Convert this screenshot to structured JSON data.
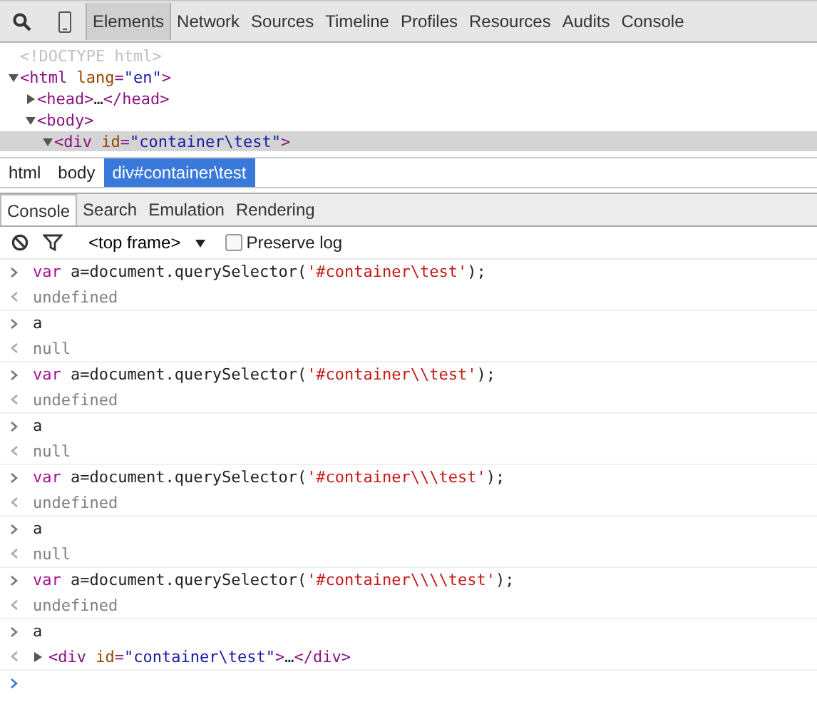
{
  "toolbar": {
    "tabs": [
      {
        "label": "Elements",
        "selected": true
      },
      {
        "label": "Network",
        "selected": false
      },
      {
        "label": "Sources",
        "selected": false
      },
      {
        "label": "Timeline",
        "selected": false
      },
      {
        "label": "Profiles",
        "selected": false
      },
      {
        "label": "Resources",
        "selected": false
      },
      {
        "label": "Audits",
        "selected": false
      },
      {
        "label": "Console",
        "selected": false
      }
    ]
  },
  "dom_tree": [
    {
      "selected": false,
      "segments": [
        {
          "kind": "doctype",
          "text": "<!DOCTYPE html>"
        }
      ]
    },
    {
      "expanded": true,
      "selected": false,
      "segments": [
        {
          "kind": "tag",
          "text": "<html "
        },
        {
          "kind": "attr",
          "text": "lang"
        },
        {
          "kind": "tag",
          "text": "="
        },
        {
          "kind": "value",
          "text": "\"en\""
        },
        {
          "kind": "tag",
          "text": ">"
        }
      ],
      "children": [
        {
          "expanded": false,
          "selected": false,
          "segments": [
            {
              "kind": "tag",
              "text": "<head>"
            },
            {
              "kind": "plain",
              "text": "…"
            },
            {
              "kind": "tag",
              "text": "</head>"
            }
          ]
        },
        {
          "expanded": true,
          "selected": false,
          "segments": [
            {
              "kind": "tag",
              "text": "<body>"
            }
          ],
          "children": [
            {
              "expanded": true,
              "selected": true,
              "segments": [
                {
                  "kind": "tag",
                  "text": "<div "
                },
                {
                  "kind": "attr",
                  "text": "id"
                },
                {
                  "kind": "tag",
                  "text": "="
                },
                {
                  "kind": "value",
                  "text": "\"container\\test\""
                },
                {
                  "kind": "tag",
                  "text": ">"
                }
              ]
            }
          ]
        }
      ]
    }
  ],
  "breadcrumbs": [
    {
      "label": "html",
      "selected": false
    },
    {
      "label": "body",
      "selected": false
    },
    {
      "label": "div#container\\test",
      "selected": true
    }
  ],
  "drawer_tabs": [
    {
      "label": "Console",
      "selected": true
    },
    {
      "label": "Search",
      "selected": false
    },
    {
      "label": "Emulation",
      "selected": false
    },
    {
      "label": "Rendering",
      "selected": false
    }
  ],
  "console_toolbar": {
    "frame": "<top frame>",
    "preserve_log": {
      "label": "Preserve log",
      "checked": false
    }
  },
  "console": [
    [
      {
        "kind": "input",
        "segments": [
          {
            "kind": "keyword",
            "text": "var"
          },
          {
            "kind": "plain",
            "text": " a=document.querySelector("
          },
          {
            "kind": "string",
            "text": "'#container\\test'"
          },
          {
            "kind": "plain",
            "text": ");"
          }
        ]
      },
      {
        "kind": "output",
        "segments": [
          {
            "kind": "muted",
            "text": "undefined"
          }
        ]
      }
    ],
    [
      {
        "kind": "input",
        "segments": [
          {
            "kind": "plain",
            "text": "a"
          }
        ]
      },
      {
        "kind": "output",
        "segments": [
          {
            "kind": "muted",
            "text": "null"
          }
        ]
      }
    ],
    [
      {
        "kind": "input",
        "segments": [
          {
            "kind": "keyword",
            "text": "var"
          },
          {
            "kind": "plain",
            "text": " a=document.querySelector("
          },
          {
            "kind": "string",
            "text": "'#container\\\\test'"
          },
          {
            "kind": "plain",
            "text": ");"
          }
        ]
      },
      {
        "kind": "output",
        "segments": [
          {
            "kind": "muted",
            "text": "undefined"
          }
        ]
      }
    ],
    [
      {
        "kind": "input",
        "segments": [
          {
            "kind": "plain",
            "text": "a"
          }
        ]
      },
      {
        "kind": "output",
        "segments": [
          {
            "kind": "muted",
            "text": "null"
          }
        ]
      }
    ],
    [
      {
        "kind": "input",
        "segments": [
          {
            "kind": "keyword",
            "text": "var"
          },
          {
            "kind": "plain",
            "text": " a=document.querySelector("
          },
          {
            "kind": "string",
            "text": "'#container\\\\\\test'"
          },
          {
            "kind": "plain",
            "text": ");"
          }
        ]
      },
      {
        "kind": "output",
        "segments": [
          {
            "kind": "muted",
            "text": "undefined"
          }
        ]
      }
    ],
    [
      {
        "kind": "input",
        "segments": [
          {
            "kind": "plain",
            "text": "a"
          }
        ]
      },
      {
        "kind": "output",
        "segments": [
          {
            "kind": "muted",
            "text": "null"
          }
        ]
      }
    ],
    [
      {
        "kind": "input",
        "segments": [
          {
            "kind": "keyword",
            "text": "var"
          },
          {
            "kind": "plain",
            "text": " a=document.querySelector("
          },
          {
            "kind": "string",
            "text": "'#container\\\\\\\\test'"
          },
          {
            "kind": "plain",
            "text": ");"
          }
        ]
      },
      {
        "kind": "output",
        "segments": [
          {
            "kind": "muted",
            "text": "undefined"
          }
        ]
      }
    ],
    [
      {
        "kind": "input",
        "segments": [
          {
            "kind": "plain",
            "text": "a"
          }
        ]
      },
      {
        "kind": "output",
        "expandable": true,
        "segments": [
          {
            "kind": "tag",
            "text": "<div "
          },
          {
            "kind": "attr",
            "text": "id"
          },
          {
            "kind": "tag",
            "text": "="
          },
          {
            "kind": "value",
            "text": "\"container\\test\""
          },
          {
            "kind": "tag",
            "text": ">"
          },
          {
            "kind": "plain",
            "text": "…"
          },
          {
            "kind": "tag",
            "text": "</div>"
          }
        ]
      }
    ]
  ]
}
